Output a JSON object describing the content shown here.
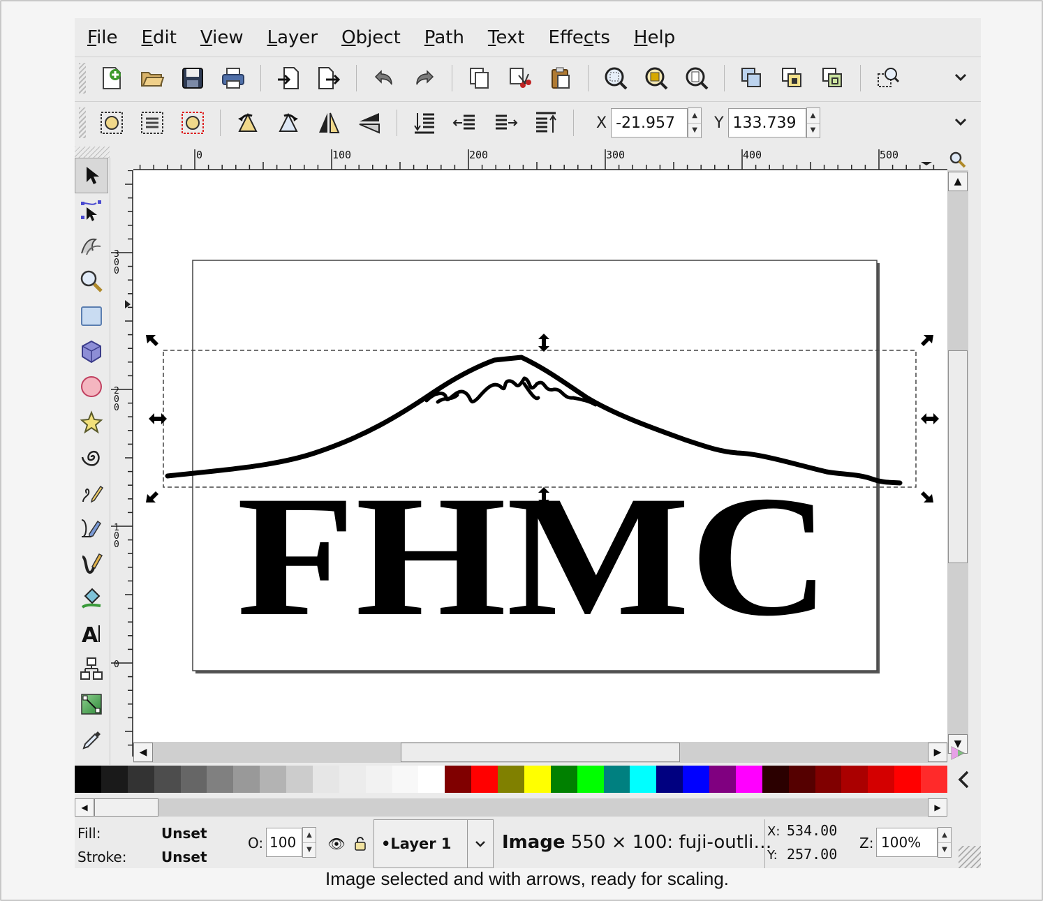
{
  "menubar": {
    "items": [
      {
        "mnemonic": "F",
        "rest": "ile"
      },
      {
        "mnemonic": "E",
        "rest": "dit"
      },
      {
        "mnemonic": "V",
        "rest": "iew"
      },
      {
        "mnemonic": "L",
        "rest": "ayer"
      },
      {
        "mnemonic": "O",
        "rest": "bject"
      },
      {
        "mnemonic": "P",
        "rest": "ath"
      },
      {
        "mnemonic": "T",
        "rest": "ext"
      },
      {
        "pre": "Effe",
        "mnemonic": "c",
        "rest": "ts"
      },
      {
        "mnemonic": "H",
        "rest": "elp"
      }
    ]
  },
  "commands_bar": {
    "icons": [
      "new-document-icon",
      "open-folder-icon",
      "save-icon",
      "print-icon",
      "import-icon",
      "export-icon",
      "undo-icon",
      "redo-icon",
      "copy-icon",
      "cut-icon",
      "paste-icon",
      "zoom-selection-icon",
      "zoom-drawing-icon",
      "zoom-page-icon",
      "duplicate-icon",
      "clone-icon",
      "unlink-clone-icon",
      "xml-editor-icon"
    ]
  },
  "tool_controls": {
    "icons": [
      "select-all-icon",
      "select-all-layers-icon",
      "deselect-icon",
      "rotate-ccw-icon",
      "rotate-cw-icon",
      "flip-horizontal-icon",
      "flip-vertical-icon",
      "raise-to-top-icon",
      "raise-icon",
      "lower-icon",
      "lower-to-bottom-icon"
    ],
    "x_label": "X",
    "x_value": "-21.957",
    "y_label": "Y",
    "y_value": "133.739"
  },
  "rulers": {
    "h_ticks": [
      "0",
      "100",
      "200",
      "300",
      "400",
      "500"
    ],
    "v_ticks": [
      "3\n0\n0",
      "2\n0\n0",
      "1\n0\n0",
      "0"
    ]
  },
  "toolbox": [
    "selector-tool-icon",
    "node-tool-icon",
    "tweak-tool-icon",
    "zoom-tool-icon",
    "rectangle-tool-icon",
    "3d-box-tool-icon",
    "ellipse-tool-icon",
    "star-tool-icon",
    "spiral-tool-icon",
    "pencil-tool-icon",
    "pen-tool-icon",
    "calligraphy-tool-icon",
    "paint-bucket-tool-icon",
    "text-tool-icon",
    "connector-tool-icon",
    "gradient-tool-icon",
    "dropper-tool-icon"
  ],
  "canvas": {
    "logo_text": "FHMC"
  },
  "palette": {
    "colors": [
      "#000000",
      "#1a1a1a",
      "#333333",
      "#4d4d4d",
      "#666666",
      "#808080",
      "#999999",
      "#b3b3b3",
      "#cccccc",
      "#e6e6e6",
      "#ececec",
      "#f2f2f2",
      "#f8f8f8",
      "#ffffff",
      "#800000",
      "#ff0000",
      "#808000",
      "#ffff00",
      "#008000",
      "#00ff00",
      "#008080",
      "#00ffff",
      "#000080",
      "#0000ff",
      "#800080",
      "#ff00ff",
      "#2b0000",
      "#550000",
      "#800000",
      "#aa0000",
      "#d40000",
      "#ff0000",
      "#ff2a2a"
    ]
  },
  "statusbar": {
    "fill_label": "Fill:",
    "fill_value": "Unset",
    "stroke_label": "Stroke:",
    "stroke_value": "Unset",
    "opacity_label": "O:",
    "opacity_value": "100",
    "layer_name": "•Layer 1",
    "message_bold": "Image",
    "message_rest": " 550 × 100: fuji-outli…",
    "cursor_x_label": "X:",
    "cursor_x": "534.00",
    "cursor_y_label": "Y:",
    "cursor_y": "257.00",
    "zoom_label": "Z:",
    "zoom_value": "100%"
  },
  "caption": "Image selected and with arrows, ready for scaling."
}
